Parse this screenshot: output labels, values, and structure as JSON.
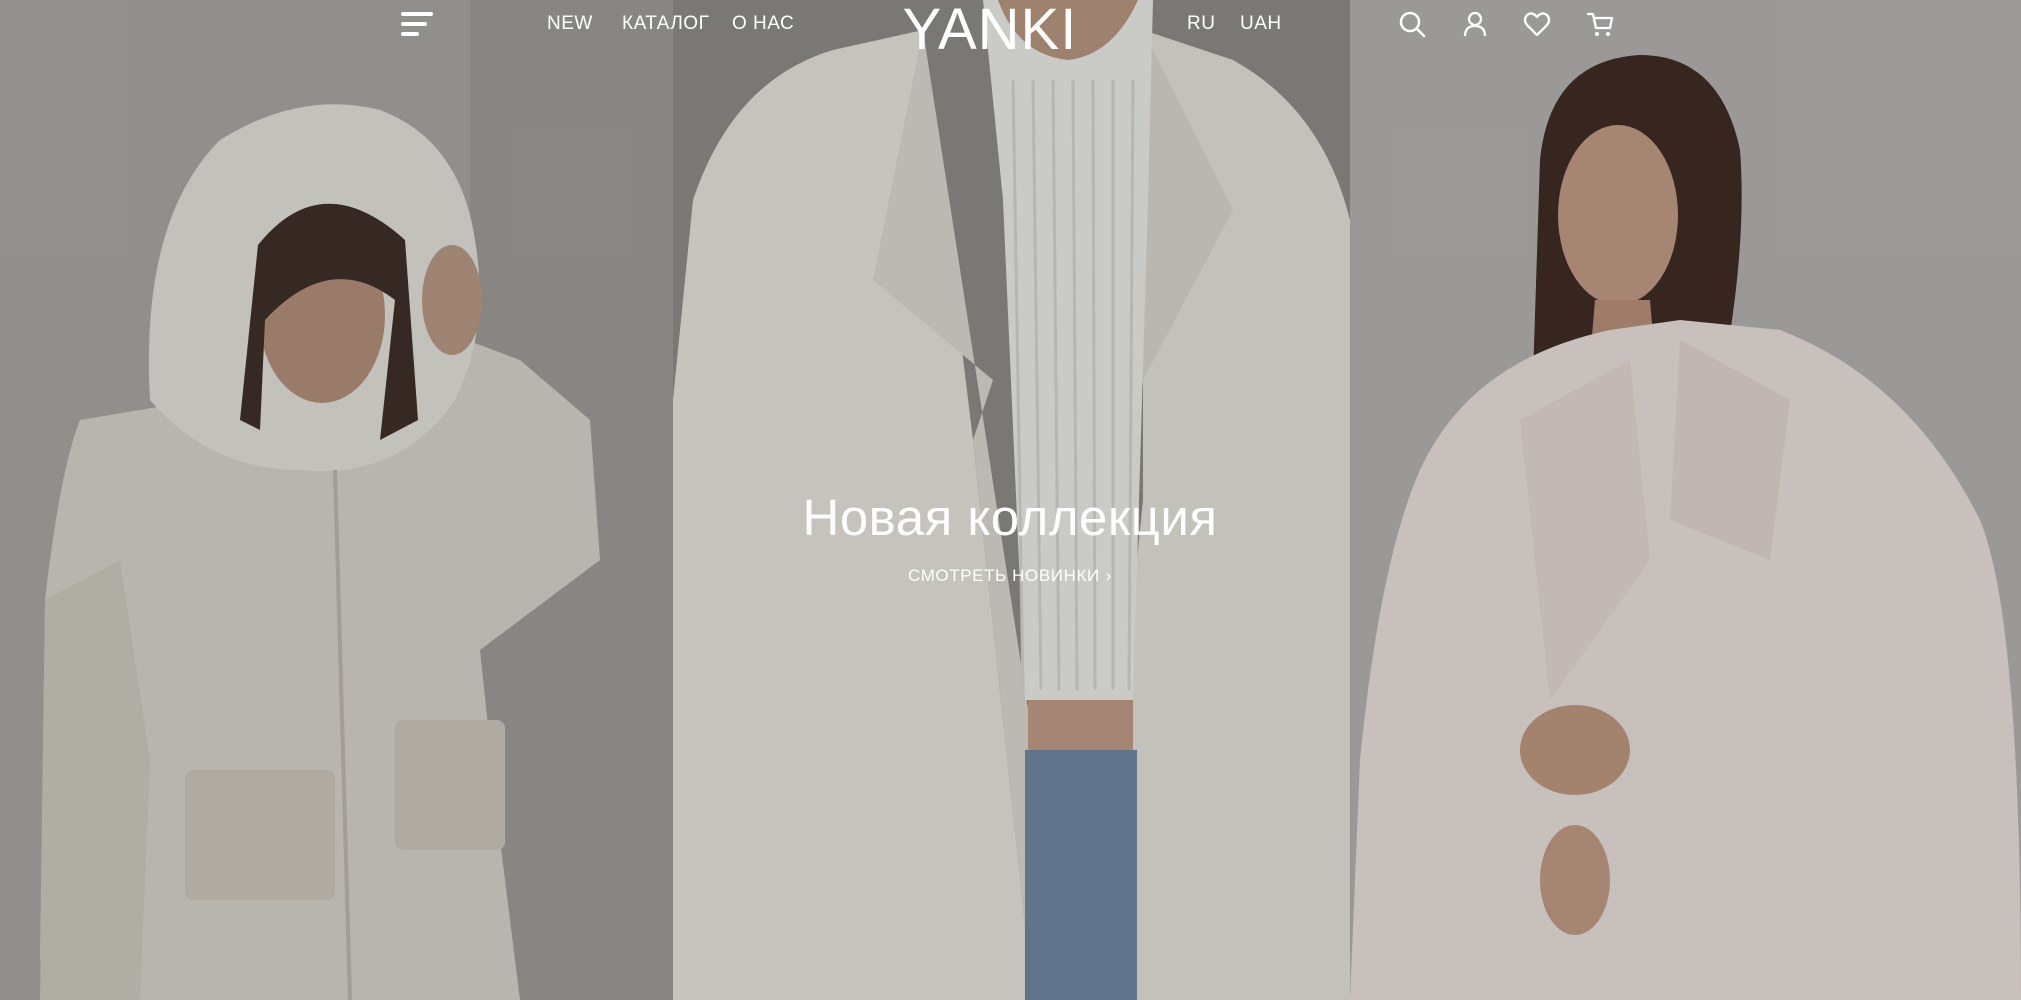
{
  "header": {
    "logo": "YANKI",
    "nav": {
      "new": "NEW",
      "catalog": "КАТАЛОГ",
      "about": "О НАС"
    },
    "language": "RU",
    "currency": "UAH",
    "icons": [
      "menu-icon",
      "search-icon",
      "user-icon",
      "heart-icon",
      "cart-icon"
    ]
  },
  "hero": {
    "title": "Новая коллекция",
    "link_label": "СМОТРЕТЬ НОВИНКИ",
    "link_arrow": "›"
  },
  "colors": {
    "text": "#ffffff",
    "background": "#9d9b98"
  }
}
